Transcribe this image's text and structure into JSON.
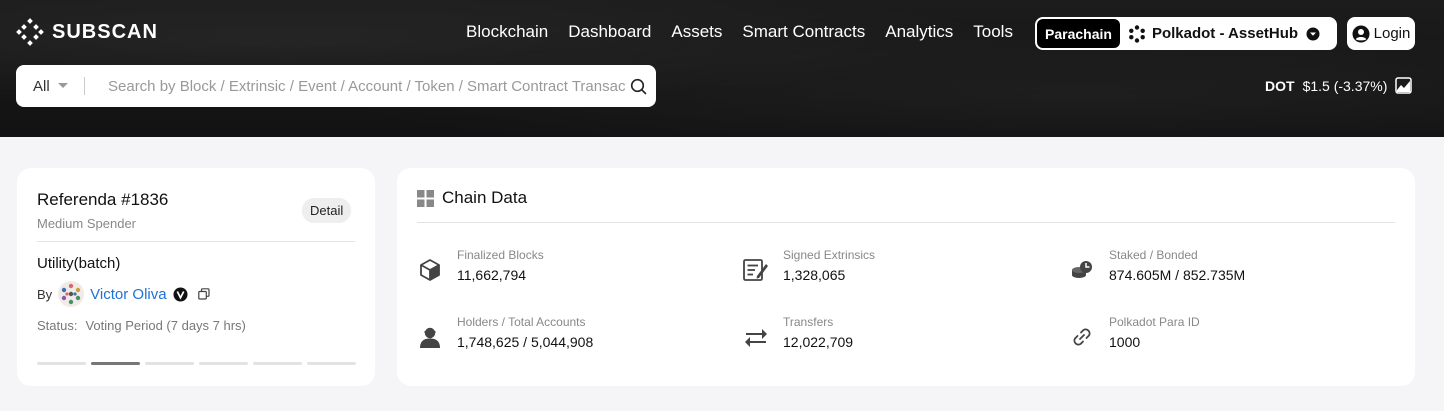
{
  "header": {
    "logo_text": "SUBSCAN",
    "nav": [
      "Blockchain",
      "Dashboard",
      "Assets",
      "Smart Contracts",
      "Analytics",
      "Tools"
    ],
    "parachain_label": "Parachain",
    "network_name": "Polkadot - AssetHub",
    "login_label": "Login"
  },
  "search": {
    "filter": "All",
    "placeholder": "Search by Block / Extrinsic / Event / Account / Token / Smart Contract Transaction"
  },
  "price": {
    "symbol": "DOT",
    "value": "$1.5 (-3.37%)"
  },
  "referenda": {
    "title": "Referenda #1836",
    "subtitle": "Medium Spender",
    "detail_label": "Detail",
    "call": "Utility(batch)",
    "by_label": "By",
    "proposer": "Victor Oliva",
    "status_label": "Status:",
    "status_value": "Voting Period (7 days 7 hrs)",
    "carousel_count": 6,
    "carousel_active_index": 1
  },
  "chain_data": {
    "title": "Chain Data",
    "stats": [
      {
        "label": "Finalized Blocks",
        "value": "11,662,794",
        "icon": "cube-icon"
      },
      {
        "label": "Signed Extrinsics",
        "value": "1,328,065",
        "icon": "signed-document-icon"
      },
      {
        "label": "Staked / Bonded",
        "value": "874.605M / 852.735M",
        "icon": "coins-icon"
      },
      {
        "label": "Holders / Total Accounts",
        "value": "1,748,625 / 5,044,908",
        "icon": "user-icon"
      },
      {
        "label": "Transfers",
        "value": "12,022,709",
        "icon": "transfer-arrows-icon"
      },
      {
        "label": "Polkadot Para ID",
        "value": "1000",
        "icon": "link-icon"
      }
    ]
  }
}
